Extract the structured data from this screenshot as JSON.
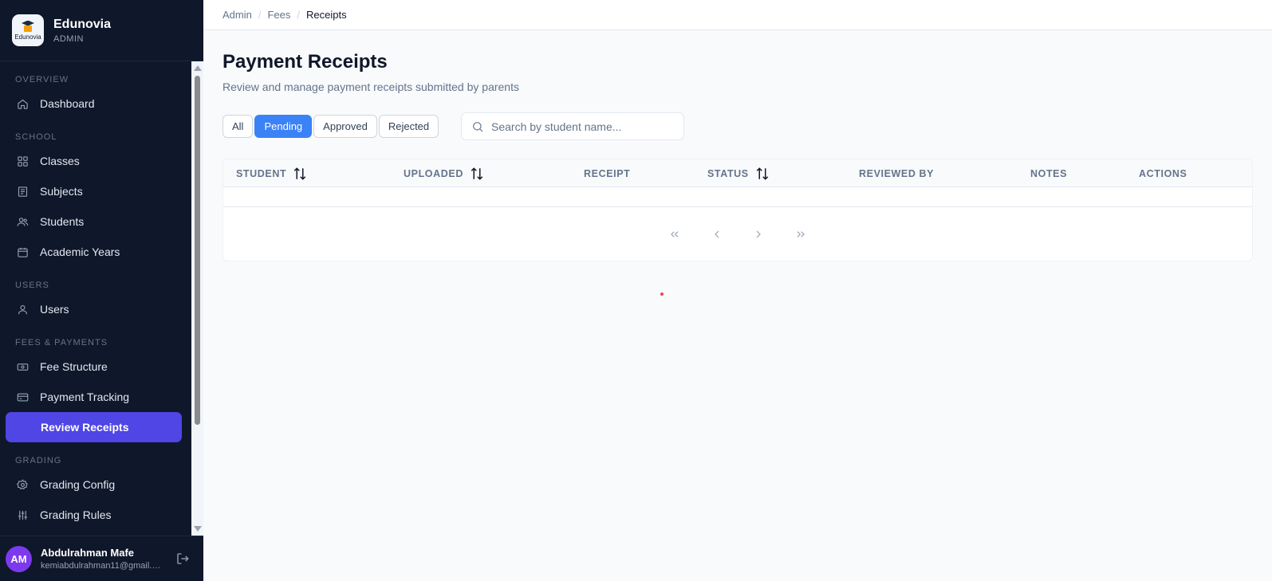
{
  "brand": {
    "name": "Edunovia",
    "role": "ADMIN",
    "logo_text": "Edunovia"
  },
  "nav": {
    "sections": [
      {
        "title": "OVERVIEW",
        "items": [
          {
            "label": "Dashboard",
            "icon": "home-icon"
          }
        ]
      },
      {
        "title": "SCHOOL",
        "items": [
          {
            "label": "Classes",
            "icon": "grid-icon"
          },
          {
            "label": "Subjects",
            "icon": "book-icon"
          },
          {
            "label": "Students",
            "icon": "users-icon"
          },
          {
            "label": "Academic Years",
            "icon": "calendar-icon"
          }
        ]
      },
      {
        "title": "USERS",
        "items": [
          {
            "label": "Users",
            "icon": "user-icon"
          }
        ]
      },
      {
        "title": "FEES & PAYMENTS",
        "items": [
          {
            "label": "Fee Structure",
            "icon": "banknote-icon"
          },
          {
            "label": "Payment Tracking",
            "icon": "credit-card-icon"
          },
          {
            "label": "Review Receipts",
            "icon": "receipt-icon",
            "active": true
          }
        ]
      },
      {
        "title": "GRADING",
        "items": [
          {
            "label": "Grading Config",
            "icon": "gear-icon"
          },
          {
            "label": "Grading Rules",
            "icon": "sliders-icon"
          }
        ]
      }
    ]
  },
  "user": {
    "initials": "AM",
    "name": "Abdulrahman Mafe",
    "email": "kemiabdulrahman11@gmail.com"
  },
  "breadcrumb": {
    "items": [
      "Admin",
      "Fees",
      "Receipts"
    ]
  },
  "page": {
    "title": "Payment Receipts",
    "subtitle": "Review and manage payment receipts submitted by parents"
  },
  "filters": {
    "options": [
      "All",
      "Pending",
      "Approved",
      "Rejected"
    ],
    "active": "Pending"
  },
  "search": {
    "placeholder": "Search by student name...",
    "value": ""
  },
  "table": {
    "columns": [
      {
        "label": "STUDENT",
        "sortable": true
      },
      {
        "label": "UPLOADED",
        "sortable": true
      },
      {
        "label": "RECEIPT",
        "sortable": false
      },
      {
        "label": "STATUS",
        "sortable": true
      },
      {
        "label": "REVIEWED BY",
        "sortable": false
      },
      {
        "label": "NOTES",
        "sortable": false
      },
      {
        "label": "ACTIONS",
        "sortable": false
      }
    ],
    "rows": []
  },
  "colors": {
    "sidebar_bg": "#0f172a",
    "active_nav": "#4f46e5",
    "active_filter": "#3b82f6",
    "avatar": "#7c3aed"
  }
}
